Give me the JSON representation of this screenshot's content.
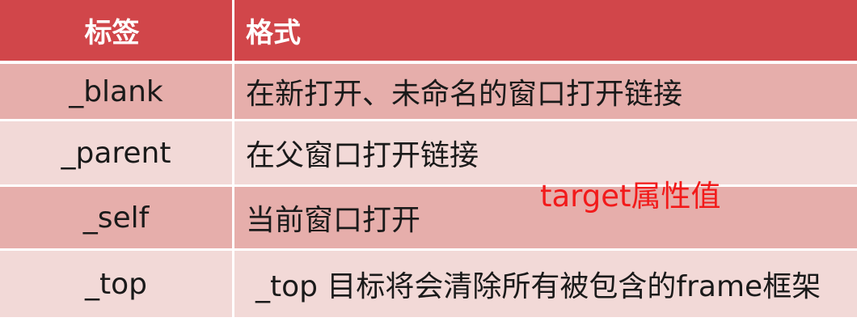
{
  "table": {
    "header": {
      "tag": "标签",
      "format": "格式"
    },
    "rows": [
      {
        "tag": "_blank",
        "format": "在新打开、未命名的窗口打开链接"
      },
      {
        "tag": "_parent",
        "format": "在父窗口打开链接"
      },
      {
        "tag": "_self",
        "format": "当前窗口打开"
      },
      {
        "tag": "_top",
        "format": "_top 目标将会清除所有被包含的frame框架"
      }
    ]
  },
  "annotation": {
    "text": "target属性值",
    "color": "#f21a1a"
  },
  "colors": {
    "header_bg": "#d1464a",
    "row_dark": "#e6aeab",
    "row_light": "#f2d9d7"
  }
}
